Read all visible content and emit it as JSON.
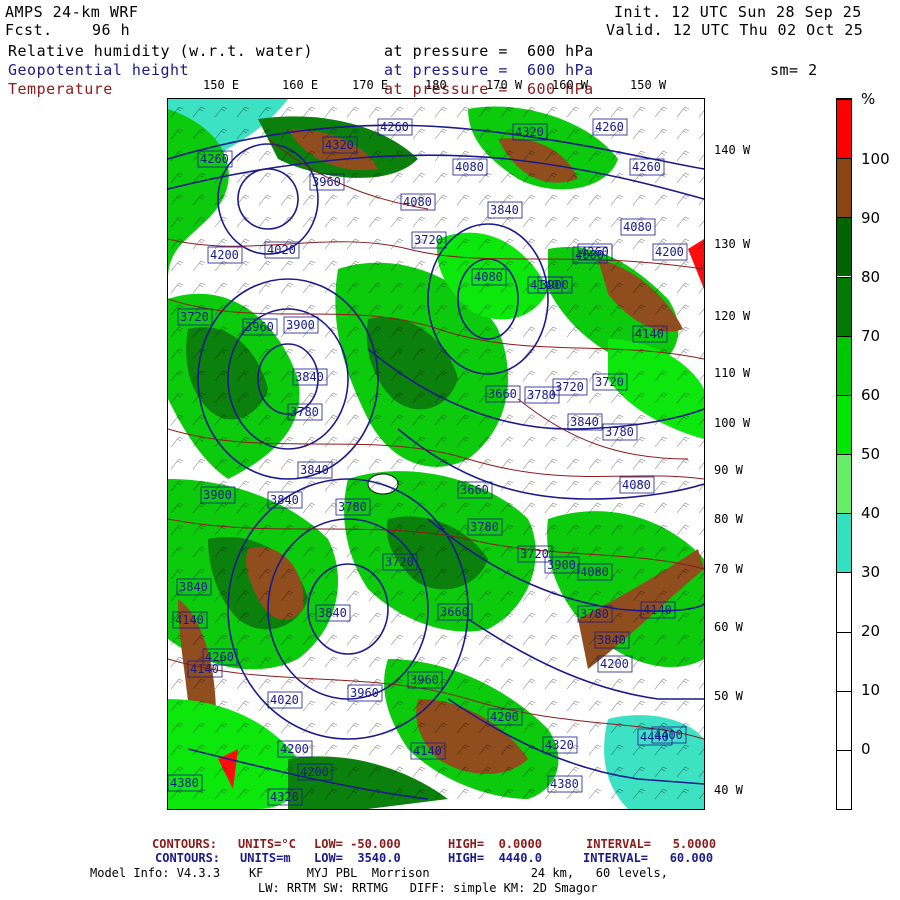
{
  "header": {
    "model": "AMPS 24-km WRF",
    "fcst_label": "Fcst.",
    "fcst_value": "96 h",
    "init": "Init. 12 UTC Sun 28 Sep 25",
    "valid": "Valid. 12 UTC Thu 02 Oct 25",
    "fields": [
      {
        "name": "Relative humidity (w.r.t. water)",
        "level": "at pressure =  600 hPa",
        "color": "#000000"
      },
      {
        "name": "Geopotential height",
        "level": "at pressure =  600 hPa",
        "color": "#1a1a8c"
      },
      {
        "name": "Temperature",
        "level": "at pressure =  600 hPa",
        "color": "#8b1a1a"
      }
    ],
    "smoothing": "sm= 2"
  },
  "top_ticks": [
    "150 E",
    "160 E",
    "170 E",
    "180",
    "170 W",
    "160 W",
    "150 W"
  ],
  "right_ticks": [
    "140 W",
    "130 W",
    "120 W",
    "110 W",
    "100 W",
    "90 W",
    "80 W",
    "70 W",
    "60 W",
    "50 W",
    "40 W"
  ],
  "colorbar": {
    "unit": "%",
    "labels": [
      "100",
      "90",
      "80",
      "70",
      "60",
      "50",
      "40",
      "30",
      "20",
      "10",
      "0"
    ],
    "segments": [
      {
        "range": "100+",
        "color": "#ff0000"
      },
      {
        "range": "90-100",
        "color": "#8b4513"
      },
      {
        "range": "80-90",
        "color": "#006400"
      },
      {
        "range": "70-80",
        "color": "#007a00"
      },
      {
        "range": "60-70",
        "color": "#00c800"
      },
      {
        "range": "50-60",
        "color": "#00e600"
      },
      {
        "range": "40-50",
        "color": "#66ee66"
      },
      {
        "range": "30-40",
        "color": "#33e0c0"
      },
      {
        "range": "20-30",
        "color": "#ffffff"
      },
      {
        "range": "10-20",
        "color": "#ffffff"
      },
      {
        "range": "0-10",
        "color": "#ffffff"
      },
      {
        "range": "<0",
        "color": "#ffffff"
      }
    ]
  },
  "contour_labels": [
    "4260",
    "4320",
    "4260",
    "4320",
    "4260",
    "4080",
    "4080",
    "3960",
    "4260",
    "4200",
    "4020",
    "3840",
    "3720",
    "4080",
    "4200",
    "4260",
    "4080",
    "4140",
    "3960",
    "3900",
    "3840",
    "3720",
    "3780",
    "3840",
    "3660",
    "4080",
    "3900",
    "4140",
    "3780",
    "3720",
    "3900",
    "3840",
    "3780",
    "3720",
    "3660",
    "3840",
    "3780",
    "3840",
    "3720",
    "3780",
    "4080",
    "4140",
    "4260",
    "4080",
    "3900",
    "3660",
    "3840",
    "3720",
    "3780",
    "3840",
    "4140",
    "4200",
    "4140",
    "4020",
    "3960",
    "3960",
    "4200",
    "4140",
    "4200",
    "4320",
    "4380",
    "4320",
    "4200",
    "4380",
    "4440",
    "4400"
  ],
  "footer": {
    "temp_contours": {
      "label": "CONTOURS:",
      "units": "UNITS=°C",
      "low": "LOW= -50.000",
      "high": "HIGH=  0.0000",
      "interval": "INTERVAL=   5.0000"
    },
    "height_contours": {
      "label": "CONTOURS:",
      "units": "UNITS=m",
      "low": "LOW=  3540.0",
      "high": "HIGH=  4440.0",
      "interval": "INTERVAL=   60.000"
    },
    "model_info": "Model Info: V4.3.3    KF      MYJ PBL  Morrison              24 km,   60 levels,",
    "model_info2": "LW: RRTM SW: RRTMG   DIFF: simple KM: 2D Smagor"
  }
}
